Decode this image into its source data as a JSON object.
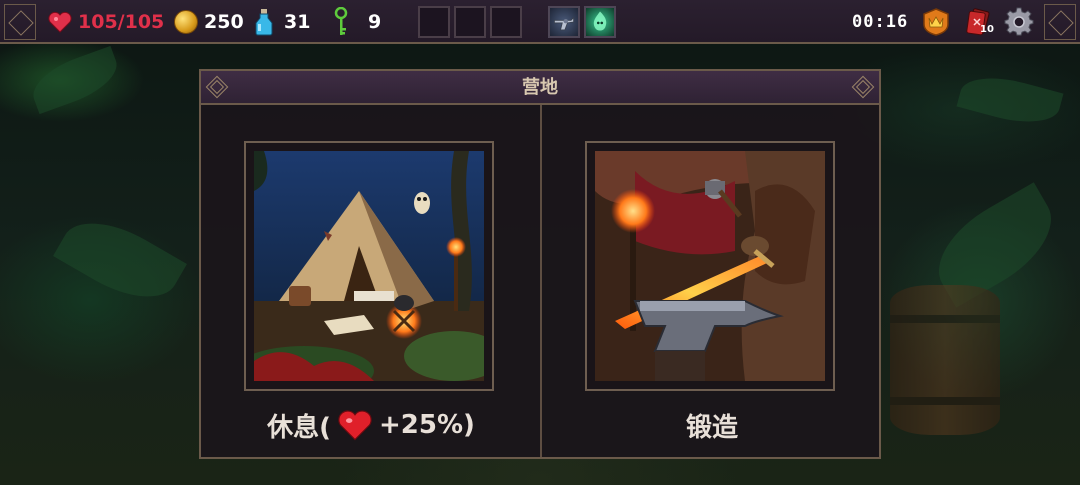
{
  "hud": {
    "health": "105/105",
    "gold": "250",
    "potions": "31",
    "keys": "9",
    "timer": "00:16",
    "deck_count": "10",
    "colors": {
      "health": "#e0304a",
      "text": "#ffffff",
      "key": "#5ecb3c"
    },
    "icons": [
      "heart-icon",
      "gold-coin-icon",
      "potion-icon",
      "key-icon",
      "crown-badge-icon",
      "card-deck-icon",
      "gear-icon"
    ],
    "relics": [
      "revolver-relic",
      "ghost-flame-relic"
    ]
  },
  "camp": {
    "title": "营地",
    "options": [
      {
        "id": "rest",
        "label_prefix": "休息(",
        "label_suffix": " +25%)",
        "icon": "heart-icon"
      },
      {
        "id": "forge",
        "label": "锻造"
      }
    ]
  }
}
